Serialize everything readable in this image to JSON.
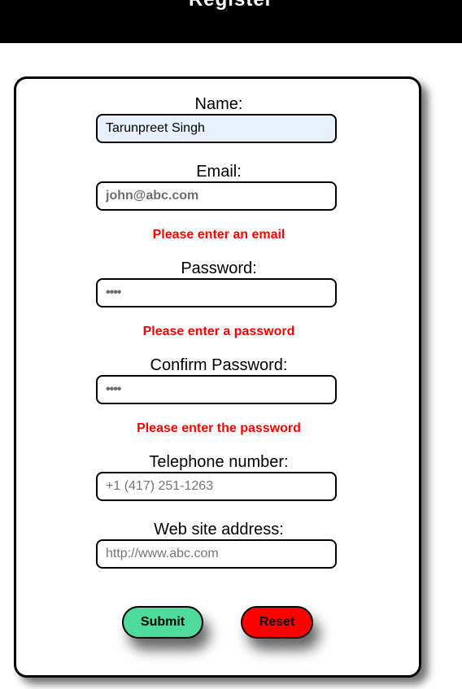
{
  "header": {
    "title": "Register"
  },
  "form": {
    "name": {
      "label": "Name:",
      "value": "Tarunpreet Singh"
    },
    "email": {
      "label": "Email:",
      "placeholder": "john@abc.com",
      "error": "Please enter an email"
    },
    "password": {
      "label": "Password:",
      "placeholder": "••••",
      "error": "Please enter a password"
    },
    "confirm": {
      "label": "Confirm Password:",
      "placeholder": "••••",
      "error": "Please enter the password"
    },
    "phone": {
      "label": "Telephone number:",
      "placeholder": "+1 (417) 251-1263"
    },
    "website": {
      "label": "Web site address:",
      "placeholder": "http://www.abc.com"
    }
  },
  "buttons": {
    "submit": "Submit",
    "reset": "Reset"
  },
  "colors": {
    "header_bg": "#000000",
    "submit_bg": "#4fdb9c",
    "reset_bg": "#ff0000",
    "error_text": "#ff0000",
    "autofill_bg": "#e8f0fe"
  }
}
